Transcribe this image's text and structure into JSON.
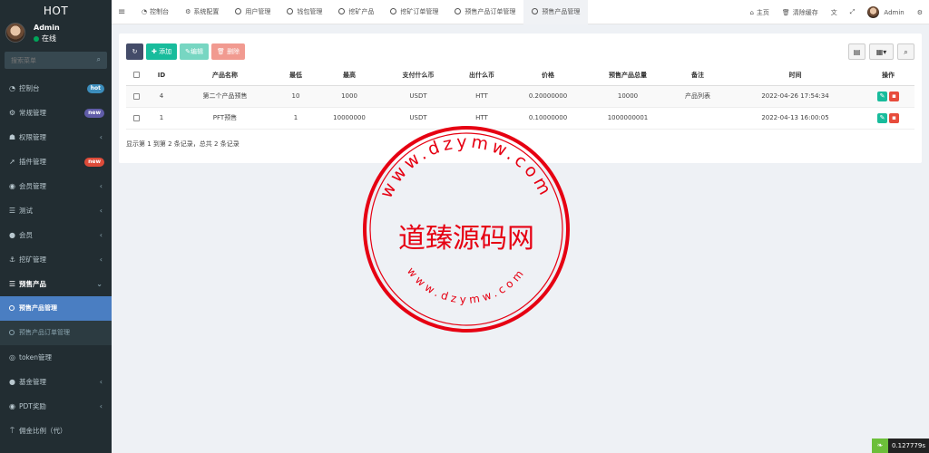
{
  "app": {
    "logo": "HOT"
  },
  "user": {
    "name": "Admin",
    "status": "在线"
  },
  "search": {
    "placeholder": "搜索菜单"
  },
  "sidebar": {
    "items": [
      {
        "label": "控制台",
        "badge": "hot"
      },
      {
        "label": "常规管理",
        "badge": "new"
      },
      {
        "label": "权限管理",
        "chevron": "‹"
      },
      {
        "label": "插件管理",
        "badge": "new"
      },
      {
        "label": "会员管理",
        "chevron": "‹"
      },
      {
        "label": "测试",
        "chevron": "‹"
      },
      {
        "label": "会员",
        "chevron": "‹"
      },
      {
        "label": "挖矿管理",
        "chevron": "‹"
      },
      {
        "label": "预售产品",
        "chevron": "⌄"
      }
    ],
    "submenu": [
      {
        "label": "预售产品管理"
      },
      {
        "label": "预售产品订单管理"
      }
    ],
    "items_after": [
      {
        "label": "token管理"
      },
      {
        "label": "基金管理",
        "chevron": "‹"
      },
      {
        "label": "PDT奖励",
        "chevron": "‹"
      },
      {
        "label": "佣金比例（代）"
      }
    ]
  },
  "tabs": [
    {
      "label": "控制台"
    },
    {
      "label": "系统配置"
    },
    {
      "label": "用户管理"
    },
    {
      "label": "钱包管理"
    },
    {
      "label": "挖矿产品"
    },
    {
      "label": "挖矿订单管理"
    },
    {
      "label": "预售产品订单管理"
    },
    {
      "label": "预售产品管理"
    }
  ],
  "topright": {
    "home": "主页",
    "clear_cache": "清除缓存",
    "user": "Admin"
  },
  "toolbar": {
    "add": "添加",
    "edit": "编辑",
    "delete": "删除"
  },
  "table": {
    "headers": [
      "ID",
      "产品名称",
      "最低",
      "最高",
      "支付什么币",
      "出什么币",
      "价格",
      "预售产品总量",
      "备注",
      "时间",
      "操作"
    ],
    "rows": [
      [
        "4",
        "第二个产品预售",
        "10",
        "1000",
        "USDT",
        "HTT",
        "0.20000000",
        "10000",
        "产品列表",
        "2022-04-26 17:54:34"
      ],
      [
        "1",
        "PFT预售",
        "1",
        "10000000",
        "USDT",
        "HTT",
        "0.10000000",
        "1000000001",
        "",
        "2022-04-13 16:00:05"
      ]
    ]
  },
  "pagination": {
    "info": "显示第 1 到第 2 条记录，总共 2 条记录"
  },
  "watermark": {
    "center": "道臻源码网",
    "top_arc": "www.dzymw.com",
    "bottom_arc": "www.dzymw.com",
    "color": "#e60012"
  },
  "trace": {
    "value": "0.127779s"
  },
  "colors": {
    "sidebar": "#222d32",
    "active": "#4a7ec2",
    "green": "#18bc9c",
    "red": "#e74c3c"
  }
}
